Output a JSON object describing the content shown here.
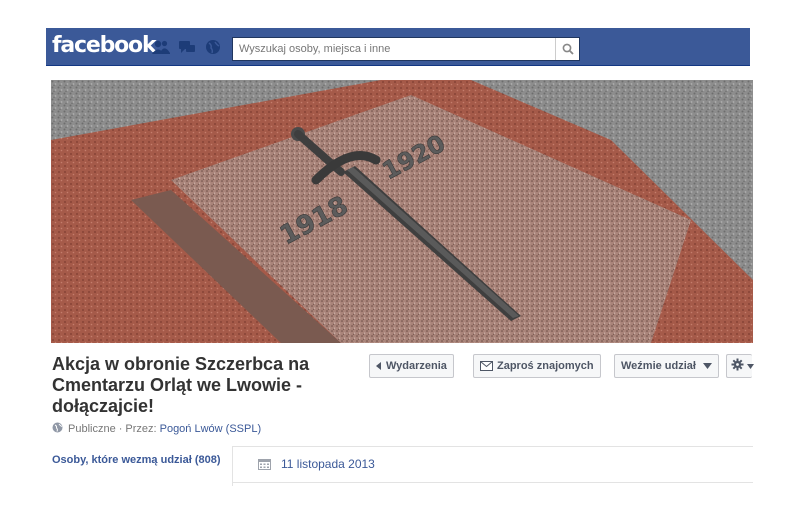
{
  "header": {
    "logo": "facebook",
    "search_placeholder": "Wyszukaj osoby, miejsca i inne"
  },
  "icons": {
    "friends": "friends-icon",
    "messages": "messages-icon",
    "notifications": "globe-icon",
    "search": "search-icon"
  },
  "cover": {
    "year_left": "1918",
    "year_right": "1920"
  },
  "event": {
    "title": "Akcja w obronie Szczerbca na Cmentarzu Orląt we Lwowie - dołączajcie!",
    "privacy": "Publiczne",
    "by_label": "· Przez:",
    "organizer": "Pogoń Lwów (SSPL)"
  },
  "actions": {
    "events": "Wydarzenia",
    "invite": "Zaproś znajomych",
    "join": "Weźmie udział"
  },
  "sidebar": {
    "going": "Osoby, które wezmą udział (808)"
  },
  "details": {
    "date": "11 listopada 2013"
  },
  "colors": {
    "brand": "#3b5998",
    "link": "#3b5998"
  }
}
